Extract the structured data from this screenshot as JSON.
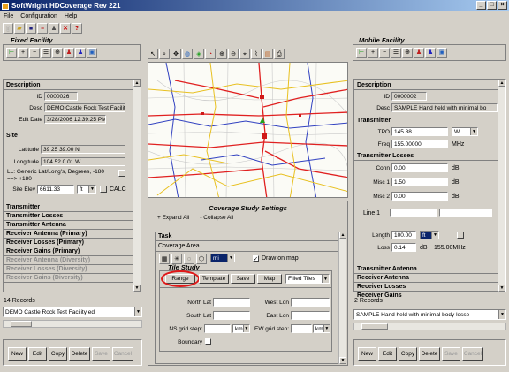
{
  "window": {
    "title": "SoftWright HDCoverage Rev 221",
    "controls": [
      "_",
      "□",
      "×"
    ]
  },
  "menu": [
    "File",
    "Configuration",
    "Help"
  ],
  "fixed": {
    "group_title": "Fixed Facility",
    "description": {
      "heading": "Description",
      "id_label": "ID",
      "id_value": "0000026",
      "desc_label": "Desc",
      "desc_value": "DEMO Castle Rock Test Facilit",
      "edit_label": "Edit Date",
      "edit_value": "3/28/2006 12:39:25 PM"
    },
    "site": {
      "heading": "Site",
      "lat_label": "Latitude",
      "lat_value": "39 25 39.00 N",
      "lon_label": "Longitude",
      "lon_value": "104 52 0.01 W",
      "ll_note": "LL: Generic Lat/Long's, Degrees, -180 ==> +180",
      "elev_label": "Site Elev",
      "elev_value": "6611.33",
      "elev_unit": "ft",
      "calc": "CALC"
    },
    "sections": [
      {
        "label": "Transmitter",
        "disabled": false
      },
      {
        "label": "Transmitter Losses",
        "disabled": false
      },
      {
        "label": "Transmitter Antenna",
        "disabled": false
      },
      {
        "label": "Receiver Antenna (Primary)",
        "disabled": false
      },
      {
        "label": "Receiver Losses (Primary)",
        "disabled": false
      },
      {
        "label": "Receiver Gains (Primary)",
        "disabled": false
      },
      {
        "label": "Receiver Antenna (Diversity)",
        "disabled": true
      },
      {
        "label": "Receiver Losses (Diversity)",
        "disabled": true
      },
      {
        "label": "Receiver Gains (Diversity)",
        "disabled": true
      }
    ],
    "records": "14 Records",
    "record_select": "DEMO Castle Rock Test Facility ed",
    "buttons": [
      {
        "label": "New",
        "disabled": false
      },
      {
        "label": "Edit",
        "disabled": false
      },
      {
        "label": "Copy",
        "disabled": false
      },
      {
        "label": "Delete",
        "disabled": false
      },
      {
        "label": "Save",
        "disabled": true
      },
      {
        "label": "Cancel",
        "disabled": true
      }
    ]
  },
  "coverage": {
    "title": "Coverage Study Settings",
    "expand_all": "+ Expand All",
    "collapse_all": "- Collapse All",
    "task": "Task",
    "area": "Coverage Area",
    "unit": "mi",
    "draw_on_map": "Draw on map",
    "tile_study": "Tile Study",
    "tabs": [
      "Range",
      "Template",
      "Save",
      "Map"
    ],
    "fill_option": "Filled Tiles",
    "north_lat": "North Lat",
    "west_lon": "West Lon",
    "south_lat": "South Lat",
    "east_lon": "East Lon",
    "ns_grid": "NS grid step:",
    "ew_grid": "EW grid step:",
    "km": "km",
    "boundary": "Boundary"
  },
  "mobile": {
    "group_title": "Mobile Facility",
    "description": {
      "heading": "Description",
      "id_label": "ID",
      "id_value": "0000002",
      "desc_label": "Desc",
      "desc_value": "SAMPLE Hand held with minimal bo"
    },
    "transmitter": {
      "heading": "Transmitter",
      "tpo_label": "TPO",
      "tpo_value": "145.88",
      "tpo_unit": "W",
      "freq_label": "Freq",
      "freq_value": "155.00000",
      "freq_unit": "MHz"
    },
    "tx_losses": {
      "heading": "Transmitter Losses",
      "conn_label": "Conn",
      "conn_value": "0.00",
      "misc1_label": "Misc 1",
      "misc1_value": "1.50",
      "misc2_label": "Misc 2",
      "misc2_value": "0.00",
      "db": "dB",
      "line1_label": "Line 1",
      "length_label": "Length",
      "length_value": "100.00",
      "length_unit": "ft",
      "loss_label": "Loss",
      "loss_value": "0.14",
      "loss_freq": "155.00MHz"
    },
    "sections": [
      {
        "label": "Transmitter Antenna"
      },
      {
        "label": "Receiver Antenna"
      },
      {
        "label": "Receiver Losses"
      },
      {
        "label": "Receiver Gains"
      }
    ],
    "records": "2 Records",
    "record_select": "SAMPLE Hand held with minimal body losse",
    "buttons": [
      {
        "label": "New",
        "disabled": false
      },
      {
        "label": "Edit",
        "disabled": false
      },
      {
        "label": "Copy",
        "disabled": false
      },
      {
        "label": "Delete",
        "disabled": false
      },
      {
        "label": "Save",
        "disabled": true
      },
      {
        "label": "Cancel",
        "disabled": true
      }
    ]
  }
}
